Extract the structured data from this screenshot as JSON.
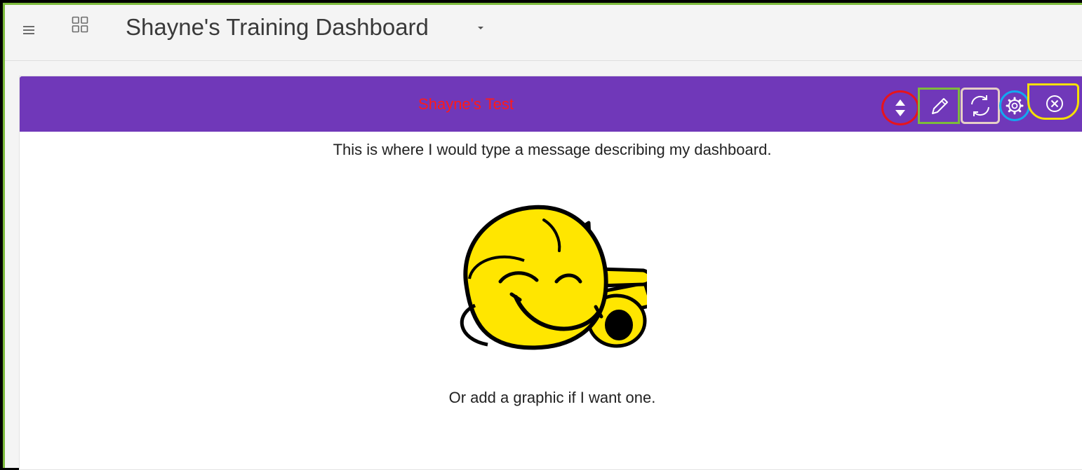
{
  "topbar": {
    "menu_icon": "hamburger-icon",
    "grid_icon": "grid-icon",
    "title": "Shayne's Training Dashboard",
    "dropdown_icon": "caret-down-icon"
  },
  "widget": {
    "title": "Shayne's Test",
    "message": "This is where I would type a message describing my dashboard.",
    "caption": "Or add a graphic if I want one.",
    "graphic": "smiling-yellow-cartoon-airplane",
    "toolbar": [
      {
        "icon": "sort-icon"
      },
      {
        "icon": "pencil-icon"
      },
      {
        "icon": "refresh-icon"
      },
      {
        "icon": "gear-icon"
      },
      {
        "icon": "close-circle-icon"
      }
    ]
  },
  "colors": {
    "header_bg": "#7038b9",
    "widget_title": "#ff1a1a",
    "frame_accent": "#7dbb3c",
    "highlight_sort": "#e8141b",
    "highlight_edit": "#7dbb3c",
    "highlight_refresh": "#e6cfc6",
    "highlight_settings": "#12a9f0",
    "highlight_close": "#f5e000"
  }
}
